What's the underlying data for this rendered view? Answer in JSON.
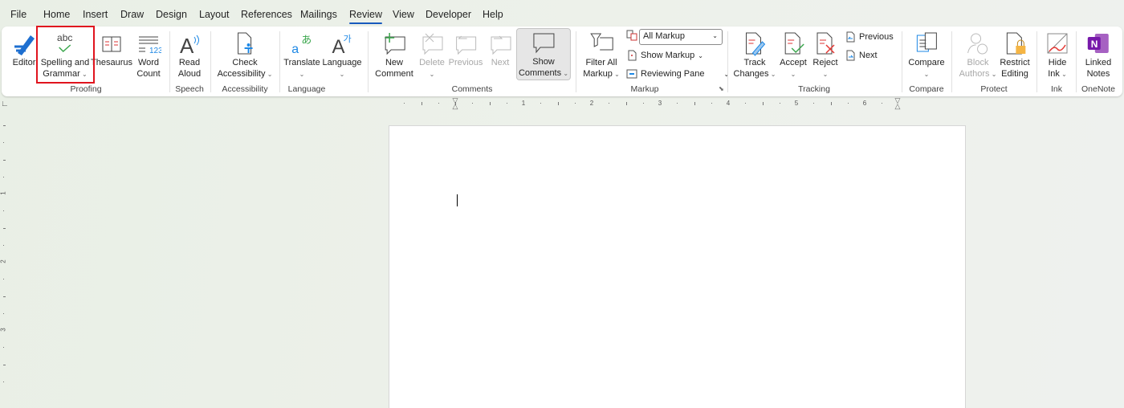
{
  "menu_tabs": [
    "File",
    "Home",
    "Insert",
    "Draw",
    "Design",
    "Layout",
    "References",
    "Mailings",
    "Review",
    "View",
    "Developer",
    "Help"
  ],
  "active_tab": "Review",
  "groups": [
    "Proofing",
    "Speech",
    "Accessibility",
    "Language",
    "Comments",
    "Markup",
    "Tracking",
    "Compare",
    "Protect",
    "Ink",
    "OneNote"
  ],
  "buttons": [
    {
      "l1": "Editor",
      "l2": "",
      "icon": "editor-pen-icon",
      "dropdown": false,
      "disabled": false
    },
    {
      "l1": "Spelling and",
      "l2": "Grammar",
      "icon": "abc-check-icon",
      "dropdown": true,
      "disabled": false
    },
    {
      "l1": "Thesaurus",
      "l2": "",
      "icon": "book-icon",
      "dropdown": false,
      "disabled": false
    },
    {
      "l1": "Word",
      "l2": "Count",
      "icon": "word-count-icon",
      "dropdown": false,
      "disabled": false
    },
    {
      "l1": "Read",
      "l2": "Aloud",
      "icon": "read-aloud-icon",
      "dropdown": false,
      "disabled": false
    },
    {
      "l1": "Check",
      "l2": "Accessibility",
      "icon": "accessibility-icon",
      "dropdown": true,
      "disabled": false
    },
    {
      "l1": "Translate",
      "l2": "",
      "icon": "translate-icon",
      "dropdown": true,
      "disabled": false
    },
    {
      "l1": "Language",
      "l2": "",
      "icon": "language-icon",
      "dropdown": true,
      "disabled": false
    },
    {
      "l1": "New",
      "l2": "Comment",
      "icon": "new-comment-icon",
      "dropdown": false,
      "disabled": false
    },
    {
      "l1": "Delete",
      "l2": "",
      "icon": "delete-comment-icon",
      "dropdown": true,
      "disabled": true
    },
    {
      "l1": "Previous",
      "l2": "",
      "icon": "previous-comment-icon",
      "dropdown": false,
      "disabled": true
    },
    {
      "l1": "Next",
      "l2": "",
      "icon": "next-comment-icon",
      "dropdown": false,
      "disabled": true
    },
    {
      "l1": "Show",
      "l2": "Comments",
      "icon": "show-comments-icon",
      "dropdown": true,
      "disabled": false,
      "pressed": true
    },
    {
      "l1": "Filter All",
      "l2": "Markup",
      "icon": "filter-icon",
      "dropdown": true,
      "disabled": false
    },
    {
      "l1": "Track",
      "l2": "Changes",
      "icon": "track-changes-icon",
      "dropdown": true,
      "disabled": false
    },
    {
      "l1": "Accept",
      "l2": "",
      "icon": "accept-icon",
      "dropdown": true,
      "disabled": false
    },
    {
      "l1": "Reject",
      "l2": "",
      "icon": "reject-icon",
      "dropdown": true,
      "disabled": false
    },
    {
      "l1": "Compare",
      "l2": "",
      "icon": "compare-icon",
      "dropdown": true,
      "disabled": false
    },
    {
      "l1": "Block",
      "l2": "Authors",
      "icon": "block-authors-icon",
      "dropdown": true,
      "disabled": true
    },
    {
      "l1": "Restrict",
      "l2": "Editing",
      "icon": "lock-icon",
      "dropdown": false,
      "disabled": false
    },
    {
      "l1": "Hide",
      "l2": "Ink",
      "icon": "ink-icon",
      "dropdown": true,
      "disabled": false
    },
    {
      "l1": "Linked",
      "l2": "Notes",
      "icon": "onenote-icon",
      "dropdown": false,
      "disabled": false
    }
  ],
  "markup": {
    "display_select": "All Markup",
    "show_markup": "Show Markup",
    "reviewing_pane": "Reviewing Pane"
  },
  "tracking": {
    "previous": "Previous",
    "next": "Next"
  },
  "ruler_numbers": [
    "1",
    "2",
    "3",
    "4",
    "5",
    "6"
  ],
  "vruler_numbers": [
    "1",
    "2",
    "3"
  ],
  "colors": {
    "accent": "#185abd",
    "highlight": "#e0141e"
  }
}
